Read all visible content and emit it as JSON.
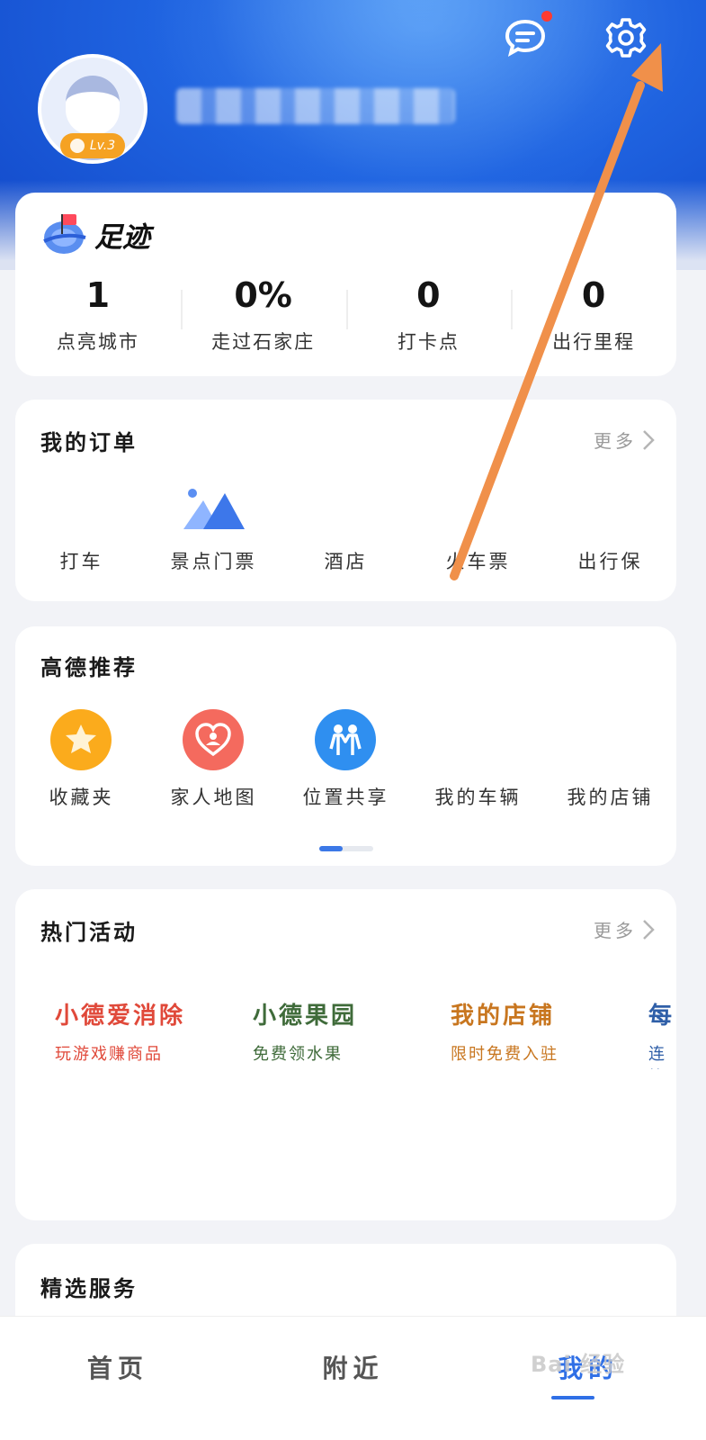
{
  "header": {
    "level_badge": "Lv.3",
    "username_blurred": "",
    "colors": {
      "hero": "#1f63e0",
      "badge": "#f5a223",
      "notification_dot": "#ff3b30"
    }
  },
  "footprint": {
    "title": "足迹",
    "stats": [
      {
        "value": "1",
        "label": "点亮城市"
      },
      {
        "value": "0%",
        "label": "走过石家庄"
      },
      {
        "value": "0",
        "label": "打卡点"
      },
      {
        "value": "0",
        "label": "出行里程"
      }
    ]
  },
  "orders": {
    "title": "我的订单",
    "more": "更多",
    "items": [
      "打车",
      "景点门票",
      "酒店",
      "火车票",
      "出行保"
    ]
  },
  "recommend": {
    "title": "高德推荐",
    "items": [
      "收藏夹",
      "家人地图",
      "位置共享",
      "我的车辆",
      "我的店铺"
    ]
  },
  "activities": {
    "title": "热门活动",
    "more": "更多",
    "items": [
      {
        "title": "小德爱消除",
        "subtitle": "玩游戏赚商品",
        "color": "#e0493a"
      },
      {
        "title": "小德果园",
        "subtitle": "免费领水果",
        "color": "#3f6b3a"
      },
      {
        "title": "我的店铺",
        "subtitle": "限时免费入驻",
        "color": "#c8761f"
      },
      {
        "title": "每",
        "subtitle": "连签",
        "color": "#2f5fa8"
      }
    ]
  },
  "services": {
    "title": "精选服务"
  },
  "tabbar": {
    "tabs": [
      {
        "label": "首页",
        "active": false
      },
      {
        "label": "附近",
        "active": false
      },
      {
        "label": "我的",
        "active": true
      }
    ]
  },
  "watermark": "Bai 经验",
  "annotation": {
    "arrow_color": "#f0904a"
  }
}
